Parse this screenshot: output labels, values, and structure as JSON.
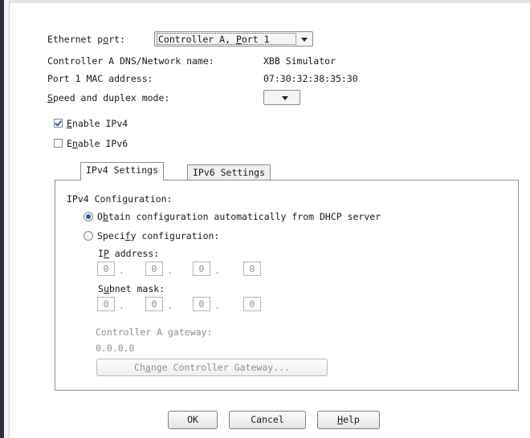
{
  "ethernet_port": {
    "label_pre": "Ethernet p",
    "label_mn": "o",
    "label_post": "rt:",
    "value_pre": "Controller A, ",
    "value_mn": "P",
    "value_post": "ort 1"
  },
  "dns_name": {
    "label": "Controller A DNS/Network name:",
    "value": "XBB Simulator"
  },
  "mac": {
    "label": "Port 1 MAC address:",
    "value": "07:30:32:38:35:30"
  },
  "speed": {
    "label_mn": "S",
    "label_post": "peed and duplex mode:",
    "value": ""
  },
  "enable_ipv4": {
    "label_mn": "E",
    "label_post": "nable IPv4",
    "checked": true
  },
  "enable_ipv6": {
    "label_pre": "E",
    "label_mn": "n",
    "label_post": "able IPv6",
    "checked": false
  },
  "tabs": [
    {
      "label": "IPv4 Settings",
      "active": true
    },
    {
      "label": "IPv6 Settings",
      "active": false
    }
  ],
  "ipv4": {
    "heading": "IPv4 Configuration:",
    "dhcp": {
      "pre": "O",
      "mn": "b",
      "post": "tain configuration automatically from DHCP server",
      "selected": true
    },
    "specify": {
      "pre": "Speci",
      "mn": "f",
      "post": "y configuration:",
      "selected": false
    },
    "ip": {
      "pre": "I",
      "mn": "P",
      "post": " address:",
      "octets": [
        "0",
        "0",
        "0",
        "0"
      ]
    },
    "subnet": {
      "pre": "S",
      "mn": "u",
      "post": "bnet mask:",
      "octets": [
        "0",
        "0",
        "0",
        "0"
      ]
    },
    "gateway": {
      "label": "Controller A gateway:",
      "value": "0.0.0.0"
    },
    "change_button": {
      "pre": "Ch",
      "mn": "a",
      "post": "nge Controller Gateway..."
    }
  },
  "buttons": {
    "ok": "OK",
    "cancel": "Cancel",
    "help_mn": "H",
    "help_post": "elp"
  }
}
